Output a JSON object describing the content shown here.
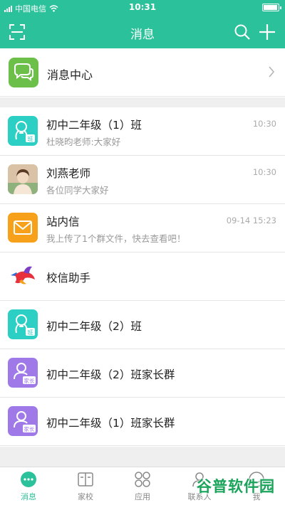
{
  "status_bar": {
    "carrier": "中国电信",
    "time": "10:31"
  },
  "header": {
    "title": "消息",
    "icons": [
      "scan-icon",
      "search-icon",
      "add-icon"
    ]
  },
  "message_center": {
    "label": "消息中心",
    "icon": "chat-bubble-icon"
  },
  "conversations": [
    {
      "title": "初中二年级（1）班",
      "preview": "杜晓昀老师:大家好",
      "time": "10:30",
      "avatar": "class-group-icon",
      "badge": "班"
    },
    {
      "title": "刘燕老师",
      "preview": "各位同学大家好",
      "time": "10:30",
      "avatar": "teacher-photo"
    },
    {
      "title": "站内信",
      "preview": "我上传了1个群文件，快去查看吧！",
      "time": "09-14 15:23",
      "avatar": "mail-icon"
    },
    {
      "title": "校信助手",
      "avatar": "bird-logo"
    },
    {
      "title": "初中二年级（2）班",
      "avatar": "class-group-icon",
      "badge": "班"
    },
    {
      "title": "初中二年级（2）班家长群",
      "avatar": "parent-group-icon",
      "badge": "家长"
    },
    {
      "title": "初中二年级（1）班家长群",
      "avatar": "parent-group-icon",
      "badge": "家长"
    }
  ],
  "tab_bar": {
    "active": "消息",
    "tabs": [
      {
        "label": "消息",
        "icon": "message-tab-icon"
      },
      {
        "label": "家校",
        "icon": "home-school-tab-icon"
      },
      {
        "label": "应用",
        "icon": "apps-tab-icon"
      },
      {
        "label": "联系人",
        "icon": "contacts-tab-icon"
      },
      {
        "label": "我",
        "icon": "me-tab-icon"
      }
    ]
  },
  "watermark": {
    "text": "谷普软件园"
  },
  "colors": {
    "brand": "#2bc19a",
    "class_group": "#2ccfc4",
    "parent_group": "#a079e8",
    "mail": "#f7a11a",
    "message_center": "#6cc04a"
  }
}
